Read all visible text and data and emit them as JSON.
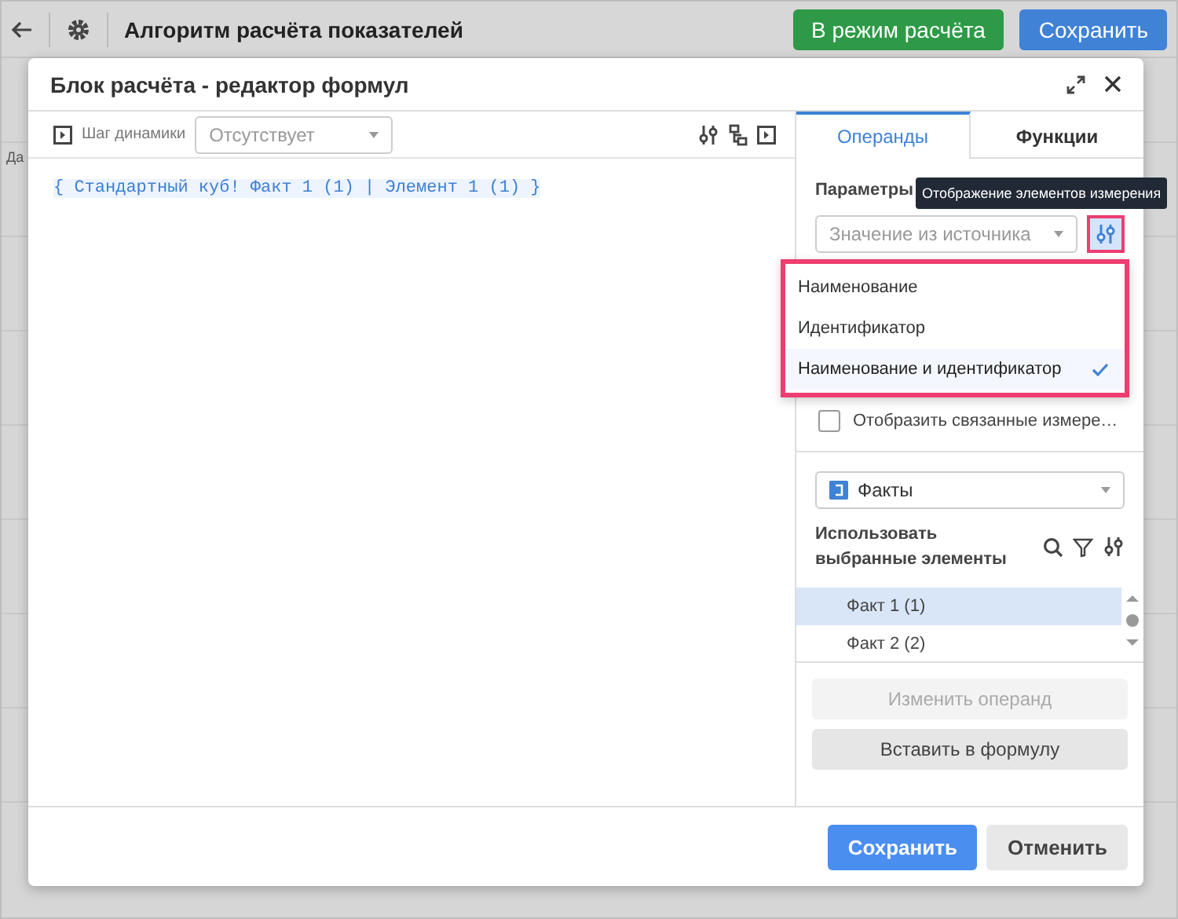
{
  "app_header": {
    "title": "Алгоритм расчёта показателей",
    "buttons": [
      {
        "label": "В режим расчёта",
        "kind": "success"
      },
      {
        "label": "Сохранить",
        "kind": "primary"
      }
    ]
  },
  "background_label": "Да",
  "dialog": {
    "title": "Блок расчёта - редактор формул",
    "toolbar": {
      "label": "Шаг динамики",
      "select": {
        "value": "Отсутствует",
        "disabled": true
      }
    },
    "formula": {
      "open": "{",
      "source": "Стандартный куб!",
      "parts": [
        "Факт 1 (1)",
        "Элемент 1 (1)"
      ],
      "separator": "|",
      "close": "}"
    },
    "tabs": [
      {
        "label": "Операнды",
        "selected": true
      },
      {
        "label": "Функции",
        "selected": false
      }
    ],
    "params_label": "Параметры",
    "tooltip": "Отображение элементов измерения",
    "value_select": {
      "value": "Значение из источника",
      "disabled": true
    },
    "display_menu": [
      {
        "label": "Наименование",
        "selected": false
      },
      {
        "label": "Идентификатор",
        "selected": false
      },
      {
        "label": "Наименование и идентификатор",
        "selected": true
      }
    ],
    "linked_checkbox": {
      "label": "Отобразить связанные измере…",
      "checked": false
    },
    "dimension_select": {
      "value": "Факты"
    },
    "use_selected_label": "Использовать выбранные элементы",
    "elements": [
      {
        "label": "Факт 1 (1)",
        "selected": true
      },
      {
        "label": "Факт 2 (2)",
        "selected": false
      }
    ],
    "operand_buttons": [
      {
        "label": "Изменить операнд",
        "disabled": true
      },
      {
        "label": "Вставить в формулу",
        "disabled": false
      }
    ],
    "footer_buttons": [
      {
        "label": "Сохранить",
        "kind": "primary"
      },
      {
        "label": "Отменить",
        "kind": "secondary"
      }
    ]
  }
}
